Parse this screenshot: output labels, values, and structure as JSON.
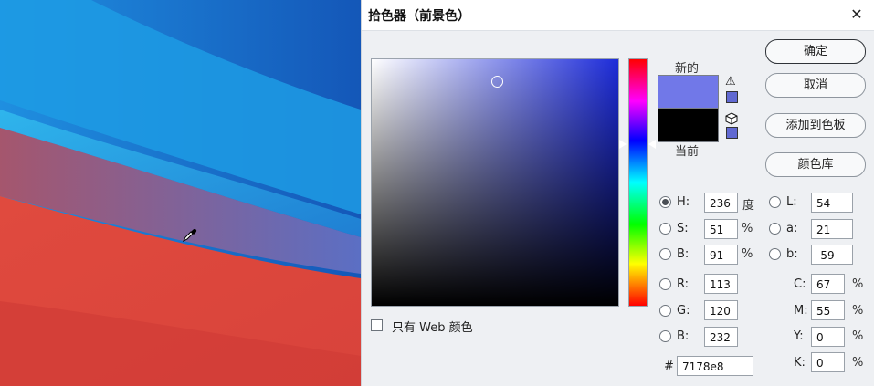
{
  "dialog": {
    "title": "拾色器（前景色）",
    "close_glyph": "✕",
    "new_label": "新的",
    "current_label": "当前",
    "warning_glyph": "⚠",
    "new_color": "#7178e8",
    "current_color": "#000000",
    "buttons": {
      "ok": "确定",
      "cancel": "取消",
      "add_to_swatches": "添加到色板",
      "color_libraries": "颜色库"
    },
    "web_only_label": "只有 Web 颜色",
    "fields": {
      "H": {
        "label": "H:",
        "value": "236",
        "unit": "度"
      },
      "S": {
        "label": "S:",
        "value": "51",
        "unit": "%"
      },
      "Bv": {
        "label": "B:",
        "value": "91",
        "unit": "%"
      },
      "R": {
        "label": "R:",
        "value": "113"
      },
      "G": {
        "label": "G:",
        "value": "120"
      },
      "Bl": {
        "label": "B:",
        "value": "232"
      },
      "L": {
        "label": "L:",
        "value": "54"
      },
      "a": {
        "label": "a:",
        "value": "21"
      },
      "b": {
        "label": "b:",
        "value": "-59"
      },
      "C": {
        "label": "C:",
        "value": "67",
        "unit": "%"
      },
      "M": {
        "label": "M:",
        "value": "55",
        "unit": "%"
      },
      "Y": {
        "label": "Y:",
        "value": "0",
        "unit": "%"
      },
      "K": {
        "label": "K:",
        "value": "0",
        "unit": "%"
      },
      "hex": {
        "label": "#",
        "value": "7178e8"
      }
    }
  }
}
